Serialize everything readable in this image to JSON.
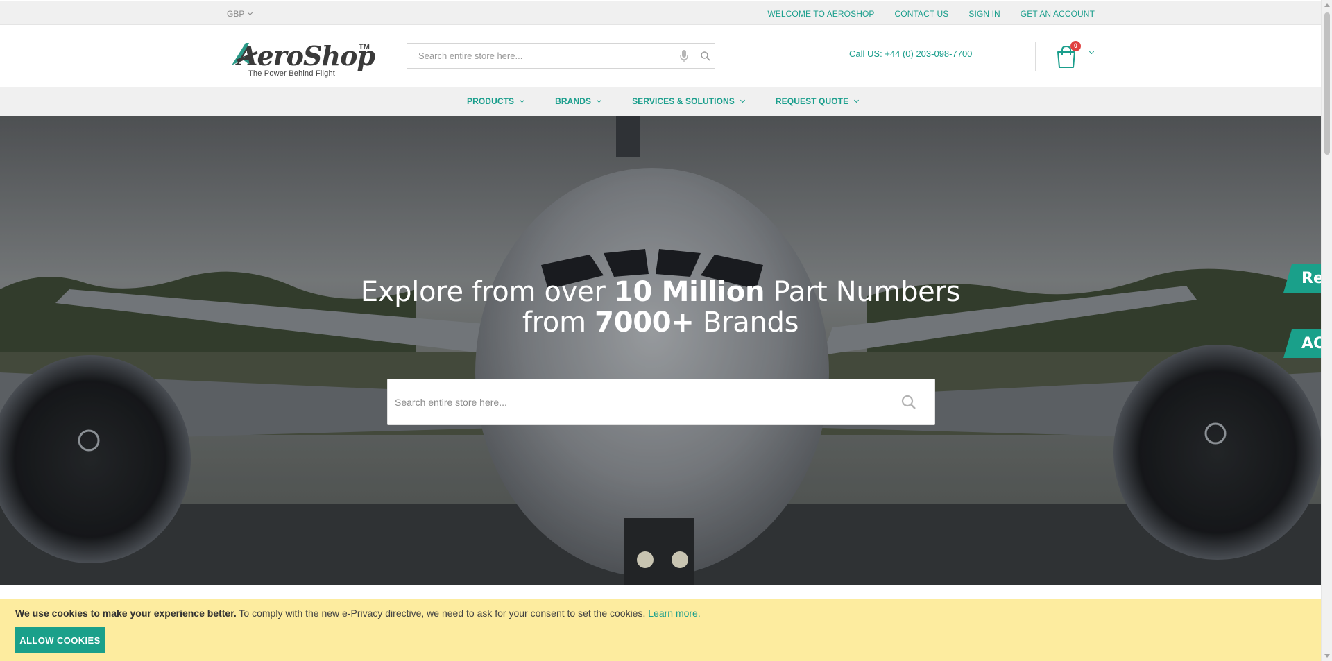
{
  "topbar": {
    "currency": "GBP",
    "links": [
      "WELCOME TO AEROSHOP",
      "CONTACT US",
      "SIGN IN",
      "GET AN ACCOUNT"
    ]
  },
  "header": {
    "logo": {
      "word": "AeroShop",
      "tm": "TM",
      "tagline": "The Power Behind Flight"
    },
    "search_placeholder": "Search entire store here...",
    "call_us": "Call US: +44 (0) 203-098-7700",
    "cart_count": "0"
  },
  "nav": {
    "items": [
      "PRODUCTS",
      "BRANDS",
      "SERVICES & SOLUTIONS",
      "REQUEST QUOTE"
    ]
  },
  "hero": {
    "title_line1_pre": "Explore from over ",
    "title_line1_bold": "10 Million",
    "title_line1_post": " Part Numbers",
    "title_line2_pre": "from ",
    "title_line2_bold": "7000+",
    "title_line2_post": " Brands",
    "search_placeholder": "Search entire store here...",
    "side_tabs": [
      "Re",
      "AO"
    ]
  },
  "cookie": {
    "bold": "We use cookies to make your experience better.",
    "text": " To comply with the new e-Privacy directive, we need to ask for your consent to set the cookies. ",
    "link": "Learn more.",
    "button": "ALLOW COOKIES"
  },
  "colors": {
    "accent": "#1a9e8c",
    "cookie_bg": "#fdec9f",
    "badge": "#e04040"
  }
}
